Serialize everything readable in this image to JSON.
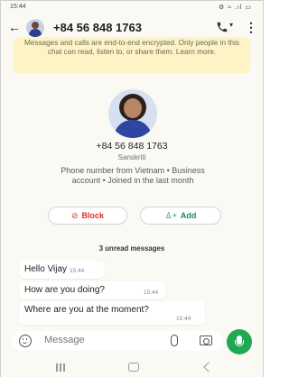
{
  "status_bar": {
    "time": "15:44",
    "icons": "⚙ ≈ .ıl ▭"
  },
  "header": {
    "title": "+84 56 848 1763",
    "back_icon": "←",
    "dropdown_icon": "▾",
    "more_icon": "⋮"
  },
  "encryption_notice": "Messages and calls are end-to-end encrypted. Only people in this chat can read, listen to, or share them. Learn more.",
  "profile": {
    "phone": "+84 56 848 1763",
    "name": "Sanskriti",
    "info": "Phone number from Vietnam • Business account • Joined in the last month"
  },
  "actions": {
    "block_label": "Block",
    "add_label": "Add",
    "block_icon": "⊘",
    "add_icon": "♙+"
  },
  "unread_label": "3 unread messages",
  "messages": [
    {
      "text": "Hello Vijay",
      "time": "15:44"
    },
    {
      "text": "How are you doing?",
      "time": "15:44"
    },
    {
      "text": "Where are you at the moment?",
      "time": "15:44"
    }
  ],
  "input": {
    "placeholder": "Message"
  },
  "colors": {
    "accent": "#1ea952",
    "danger": "#d93025",
    "notice_bg": "#fdf3c4"
  }
}
